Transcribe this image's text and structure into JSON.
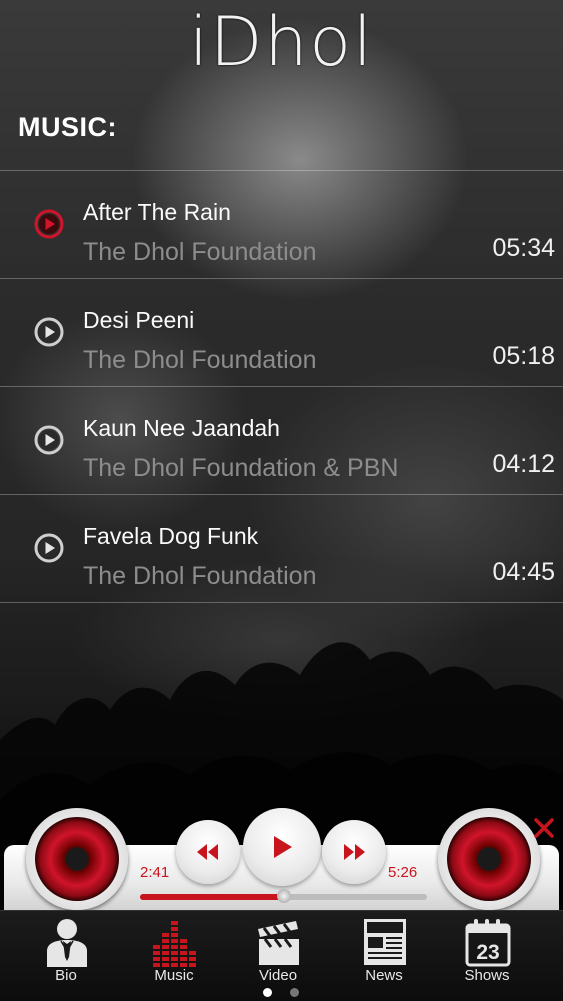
{
  "app": {
    "logo": "iDhol"
  },
  "music": {
    "heading": "MUSIC:",
    "tracks": [
      {
        "title": "After The Rain",
        "artist": "The Dhol Foundation",
        "duration": "05:34",
        "active": true
      },
      {
        "title": "Desi Peeni",
        "artist": "The Dhol Foundation",
        "duration": "05:18",
        "active": false
      },
      {
        "title": "Kaun Nee Jaandah",
        "artist": "The Dhol Foundation & PBN",
        "duration": "04:12",
        "active": false
      },
      {
        "title": "Favela Dog Funk",
        "artist": "The Dhol Foundation",
        "duration": "04:45",
        "active": false
      }
    ]
  },
  "player": {
    "elapsed": "2:41",
    "total": "5:26",
    "progress_fraction": 0.5,
    "icons": {
      "rewind": "rewind-icon",
      "play": "play-icon",
      "fast_forward": "fast-forward-icon",
      "close": "close-icon"
    }
  },
  "tabs": [
    {
      "label": "Bio",
      "icon": "person-icon"
    },
    {
      "label": "Music",
      "icon": "equalizer-icon"
    },
    {
      "label": "Video",
      "icon": "clapperboard-icon"
    },
    {
      "label": "News",
      "icon": "newspaper-icon"
    },
    {
      "label": "Shows",
      "icon": "calendar-icon",
      "icon_text": "23",
      "icon_header": ""
    }
  ],
  "colors": {
    "accent": "#c8141d",
    "secondary_text": "#8d8d8d"
  },
  "pager": {
    "pages": 2,
    "current": 1
  }
}
